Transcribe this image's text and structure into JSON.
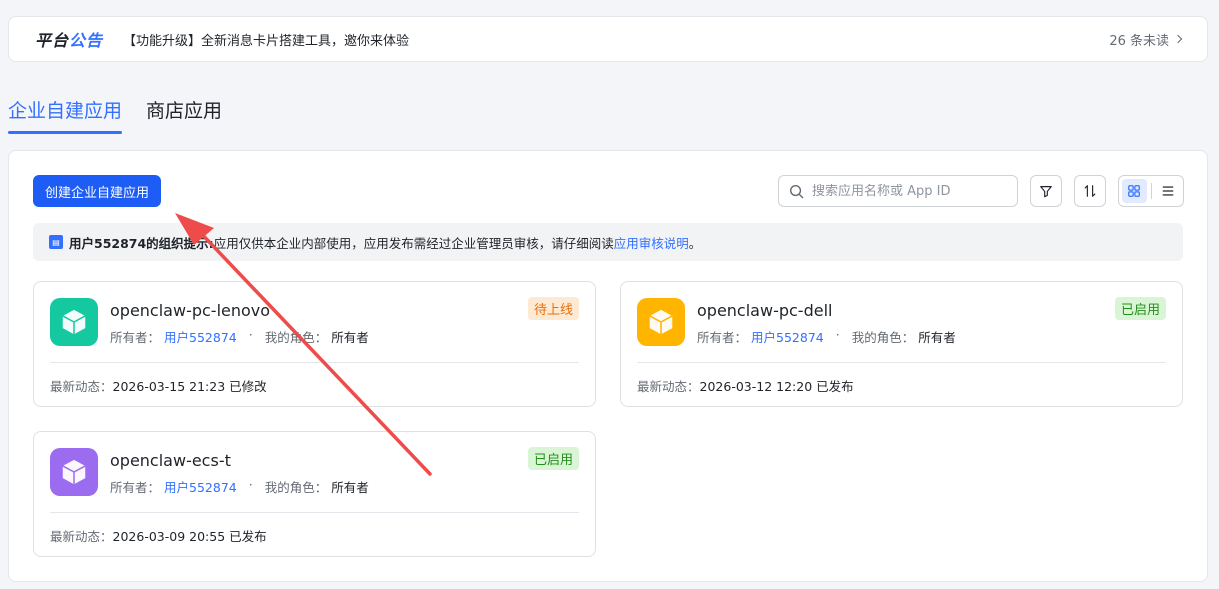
{
  "notice": {
    "logo_part1": "平台",
    "logo_part2": "公告",
    "text": "【功能升级】全新消息卡片搭建工具，邀你来体验",
    "unread": "26 条未读"
  },
  "tabs": [
    {
      "label": "企业自建应用",
      "active": true
    },
    {
      "label": "商店应用",
      "active": false
    }
  ],
  "toolbar": {
    "create_label": "创建企业自建应用",
    "search_placeholder": "搜索应用名称或 App ID"
  },
  "tip": {
    "icon": "note-icon",
    "prefix": "用户552874的组织提示:",
    "body": "应用仅供本企业内部使用，应用发布需经过企业管理员审核，请仔细阅读",
    "link": "应用审核说明",
    "suffix": "。"
  },
  "labels": {
    "owner": "所有者：",
    "role": "我的角色：",
    "activity": "最新动态："
  },
  "apps": [
    {
      "name": "openclaw-pc-lenovo",
      "owner": "用户552874",
      "role": "所有者",
      "status": "待上线",
      "activity": "2026-03-15 21:23 已修改",
      "color": "#14c9a0"
    },
    {
      "name": "openclaw-pc-dell",
      "owner": "用户552874",
      "role": "所有者",
      "status": "已启用",
      "activity": "2026-03-12 12:20 已发布",
      "color": "#ffb400"
    },
    {
      "name": "openclaw-ecs-t",
      "owner": "用户552874",
      "role": "所有者",
      "status": "已启用",
      "activity": "2026-03-09 20:55 已发布",
      "color": "#9b6cf0"
    }
  ],
  "colors": {
    "accent": "#3370ff",
    "annotation_arrow": "#ee4b4b"
  }
}
